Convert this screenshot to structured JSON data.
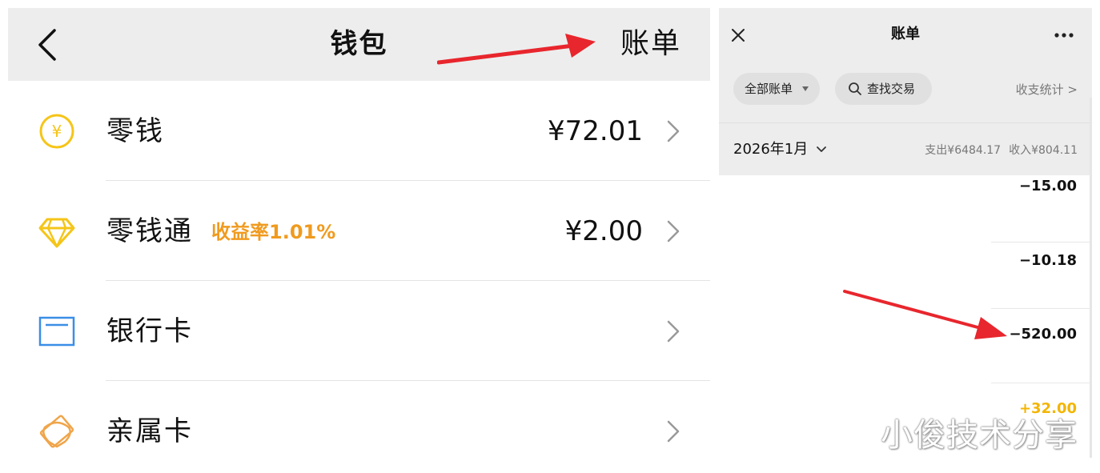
{
  "wallet": {
    "title": "钱包",
    "bill_link": "账单",
    "rows": [
      {
        "label": "零钱",
        "amount": "¥72.01",
        "icon": "yen-coin-icon",
        "color": "#f5c518"
      },
      {
        "label": "零钱通",
        "badge": "收益率1.01%",
        "amount": "¥2.00",
        "icon": "diamond-icon",
        "color": "#f5c518"
      },
      {
        "label": "银行卡",
        "icon": "bank-card-icon",
        "color": "#3a8ee6"
      },
      {
        "label": "亲属卡",
        "icon": "family-card-icon",
        "color": "#f0a54a"
      }
    ]
  },
  "bills": {
    "title": "账单",
    "filter_all": "全部账单",
    "search_label": "查找交易",
    "stats_link": "收支统计 >",
    "month": "2026年1月",
    "expense": "支出¥6484.17",
    "income": "收入¥804.11",
    "transactions": [
      {
        "amount": "−15.00",
        "type": "expense"
      },
      {
        "amount": "−10.18",
        "type": "expense"
      },
      {
        "amount": "−520.00",
        "type": "expense"
      },
      {
        "amount": "+32.00",
        "type": "income"
      }
    ]
  },
  "watermark": "小俊技术分享",
  "colors": {
    "annotation_arrow": "#e8262d",
    "income_amount": "#f3b500",
    "badge": "#f09a1e",
    "header_bg": "#ededed"
  }
}
